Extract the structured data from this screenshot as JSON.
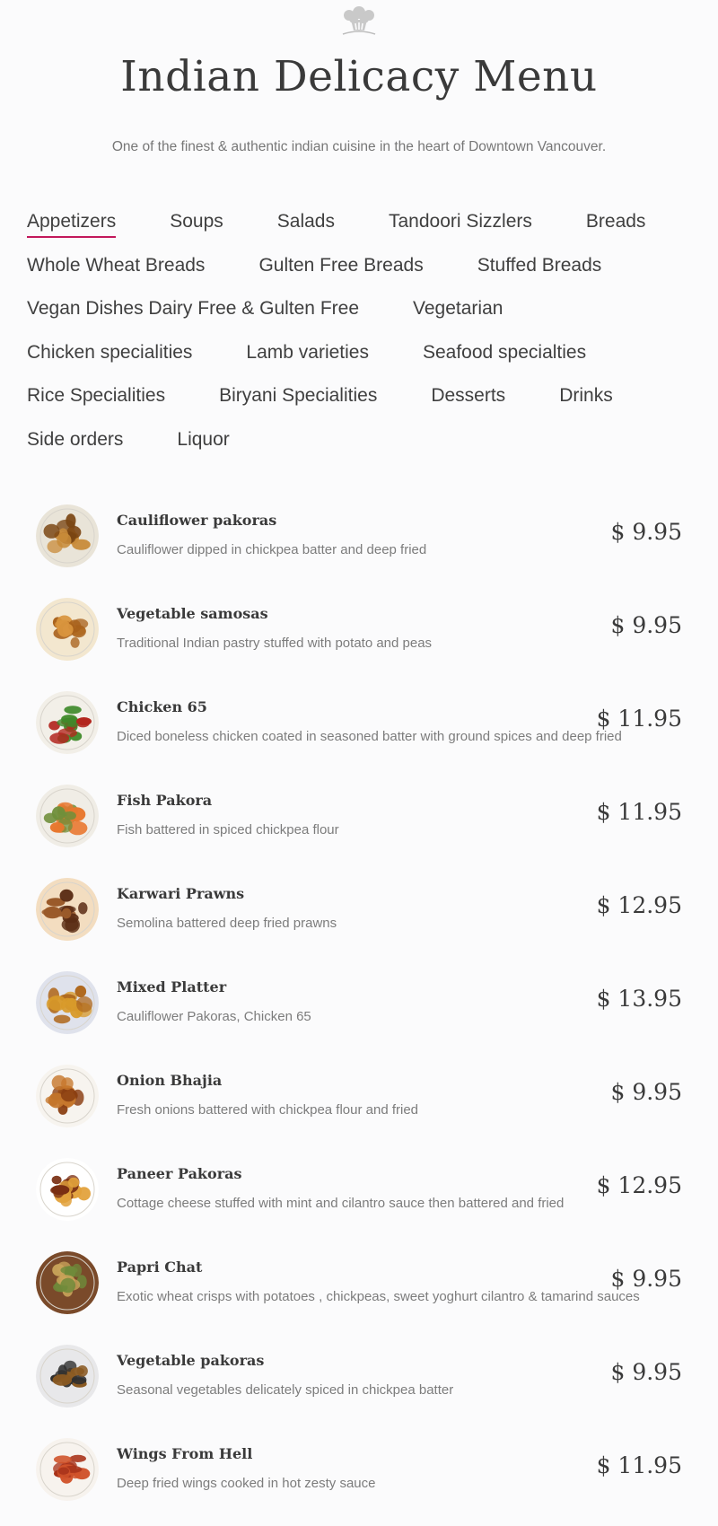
{
  "header": {
    "title": "Indian Delicacy Menu",
    "subtitle": "One of the finest & authentic indian cuisine in the heart of Downtown Vancouver."
  },
  "nav": {
    "active": "Appetizers",
    "rows": [
      [
        "Appetizers",
        "Soups",
        "Salads",
        "Tandoori Sizzlers",
        "Breads"
      ],
      [
        "Whole Wheat Breads",
        "Gulten Free Breads",
        "Stuffed Breads"
      ],
      [
        "Vegan Dishes Dairy Free & Gulten Free",
        "Vegetarian"
      ],
      [
        "Chicken specialities",
        "Lamb varieties",
        "Seafood specialties"
      ],
      [
        "Rice Specialities",
        "Biryani Specialities",
        "Desserts",
        "Drinks"
      ],
      [
        "Side orders",
        "Liquor"
      ]
    ]
  },
  "colors": {
    "accent": "#c2185b",
    "text": "#3a3a3a",
    "muted": "#7c7c7c",
    "background": "#fbfbfc"
  },
  "menu_items": [
    {
      "name": "Cauliflower pakoras",
      "description": "Cauliflower dipped in chickpea batter and deep fried",
      "price": "$ 9.95",
      "image_icon": "cauliflower-pakoras-photo",
      "palette": [
        "#7a4512",
        "#c88b3a",
        "#e9e4d8"
      ]
    },
    {
      "name": "Vegetable samosas",
      "description": "Traditional Indian pastry stuffed with potato and peas",
      "price": "$ 9.95",
      "image_icon": "samosa-photo",
      "palette": [
        "#a8611c",
        "#d9953e",
        "#f3e7cf"
      ]
    },
    {
      "name": "Chicken 65",
      "description": "Diced boneless chicken coated in seasoned batter with ground spices and deep fried",
      "price": "$ 11.95",
      "image_icon": "chicken-65-photo",
      "palette": [
        "#b3261e",
        "#3f8a2a",
        "#f2efe8"
      ]
    },
    {
      "name": "Fish Pakora",
      "description": "Fish battered in spiced chickpea flour",
      "price": "$ 11.95",
      "image_icon": "fish-pakora-photo",
      "palette": [
        "#e8772e",
        "#6f8f3a",
        "#f0ede6"
      ]
    },
    {
      "name": "Karwari Prawns",
      "description": "Semolina battered deep fried prawns",
      "price": "$ 12.95",
      "image_icon": "karwari-prawns-photo",
      "palette": [
        "#5a2c14",
        "#9a5a2a",
        "#f3ddc0"
      ]
    },
    {
      "name": "Mixed Platter",
      "description": "Cauliflower Pakoras, Chicken 65",
      "price": "$ 13.95",
      "image_icon": "mixed-platter-photo",
      "palette": [
        "#d89a2a",
        "#b06a20",
        "#dfe2ec"
      ]
    },
    {
      "name": "Onion Bhajia",
      "description": "Fresh onions battered with chickpea flour and fried",
      "price": "$ 9.95",
      "image_icon": "onion-bhajia-photo",
      "palette": [
        "#8a3f12",
        "#c6772c",
        "#f7f4ef"
      ]
    },
    {
      "name": "Paneer Pakoras",
      "description": "Cottage cheese stuffed with mint and cilantro sauce then battered and fried",
      "price": "$ 12.95",
      "image_icon": "paneer-pakoras-photo",
      "palette": [
        "#e2a23c",
        "#7a2f14",
        "#ffffff"
      ]
    },
    {
      "name": "Papri Chat",
      "description": "Exotic wheat crisps with potatoes , chickpeas, sweet yoghurt cilantro & tamarind sauces",
      "price": "$ 9.95",
      "image_icon": "papri-chat-photo",
      "palette": [
        "#c9a45a",
        "#6f8a3a",
        "#7a4a2a"
      ]
    },
    {
      "name": "Vegetable pakoras",
      "description": "Seasonal vegetables delicately spiced in chickpea batter",
      "price": "$ 9.95",
      "image_icon": "vegetable-pakoras-photo",
      "palette": [
        "#2f2f2f",
        "#8a5a22",
        "#e8e8ea"
      ]
    },
    {
      "name": "Wings From Hell",
      "description": "Deep fried wings cooked in hot zesty sauce",
      "price": "$ 11.95",
      "image_icon": "hot-wings-photo",
      "palette": [
        "#a8321a",
        "#d0522a",
        "#f7f3ee"
      ]
    }
  ]
}
